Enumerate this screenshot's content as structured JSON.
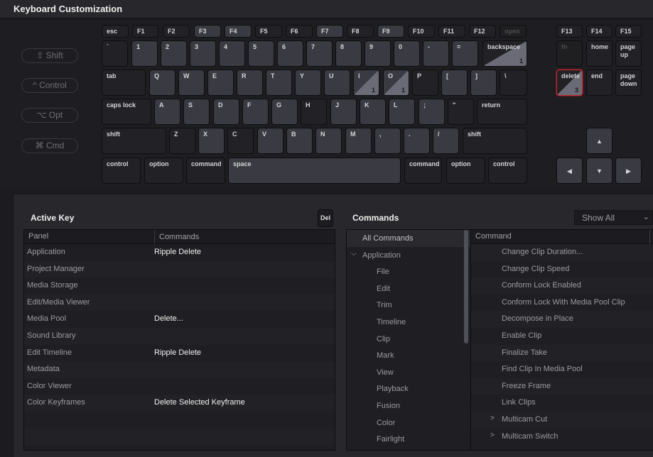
{
  "window": {
    "title": "Keyboard Customization"
  },
  "modifiers": [
    {
      "label": "⇧ Shift"
    },
    {
      "label": "^ Control"
    },
    {
      "label": "⌥ Opt"
    },
    {
      "label": "⌘ Cmd"
    }
  ],
  "keyboard": {
    "keys": [
      {
        "label": "esc",
        "style": "dark"
      },
      {
        "label": "F1",
        "style": "dark"
      },
      {
        "label": "F2",
        "style": "dark"
      },
      {
        "label": "F3",
        "style": "light"
      },
      {
        "label": "F4",
        "style": "light"
      },
      {
        "label": "F5",
        "style": "dark"
      },
      {
        "label": "F6",
        "style": "dark"
      },
      {
        "label": "F7",
        "style": "light"
      },
      {
        "label": "F8",
        "style": "dark"
      },
      {
        "label": "F9",
        "style": "light"
      },
      {
        "label": "F10",
        "style": "dark"
      },
      {
        "label": "F11",
        "style": "dark"
      },
      {
        "label": "F12",
        "style": "dark"
      },
      {
        "label": "open",
        "style": "disabled"
      },
      {
        "label": "F13",
        "style": "dark"
      },
      {
        "label": "F14",
        "style": "dark"
      },
      {
        "label": "F15",
        "style": "dark"
      },
      {
        "label": "`",
        "style": "dark"
      },
      {
        "label": "1",
        "style": "light"
      },
      {
        "label": "2",
        "style": "light"
      },
      {
        "label": "3",
        "style": "light"
      },
      {
        "label": "4",
        "style": "light"
      },
      {
        "label": "5",
        "style": "light"
      },
      {
        "label": "6",
        "style": "light"
      },
      {
        "label": "7",
        "style": "light"
      },
      {
        "label": "8",
        "style": "light"
      },
      {
        "label": "9",
        "style": "light"
      },
      {
        "label": "0",
        "style": "light"
      },
      {
        "label": "-",
        "style": "light"
      },
      {
        "label": "=",
        "style": "light"
      },
      {
        "label": "backspace",
        "style": "dark",
        "count": "1"
      },
      {
        "label": "fn",
        "style": "disabled"
      },
      {
        "label": "home",
        "style": "dark"
      },
      {
        "label": "page up",
        "style": "dark"
      },
      {
        "label": "tab",
        "style": "dark"
      },
      {
        "label": "Q",
        "style": "light"
      },
      {
        "label": "W",
        "style": "light"
      },
      {
        "label": "E",
        "style": "light"
      },
      {
        "label": "R",
        "style": "light"
      },
      {
        "label": "T",
        "style": "light"
      },
      {
        "label": "Y",
        "style": "light"
      },
      {
        "label": "U",
        "style": "light"
      },
      {
        "label": "I",
        "style": "light",
        "count": "1"
      },
      {
        "label": "O",
        "style": "light",
        "count": "1"
      },
      {
        "label": "P",
        "style": "dark"
      },
      {
        "label": "[",
        "style": "light"
      },
      {
        "label": "]",
        "style": "light"
      },
      {
        "label": "\\",
        "style": "dark"
      },
      {
        "label": "delete",
        "style": "dark",
        "count": "3",
        "selected": true
      },
      {
        "label": "end",
        "style": "dark"
      },
      {
        "label": "page down",
        "style": "dark"
      },
      {
        "label": "caps lock",
        "style": "dark"
      },
      {
        "label": "A",
        "style": "light"
      },
      {
        "label": "S",
        "style": "light"
      },
      {
        "label": "D",
        "style": "light"
      },
      {
        "label": "F",
        "style": "light"
      },
      {
        "label": "G",
        "style": "light"
      },
      {
        "label": "H",
        "style": "dark"
      },
      {
        "label": "J",
        "style": "light"
      },
      {
        "label": "K",
        "style": "light"
      },
      {
        "label": "L",
        "style": "light"
      },
      {
        "label": ";",
        "style": "light"
      },
      {
        "label": "\"",
        "style": "dark"
      },
      {
        "label": "return",
        "style": "dark"
      },
      {
        "label": "shift",
        "style": "dark"
      },
      {
        "label": "Z",
        "style": "dark"
      },
      {
        "label": "X",
        "style": "light"
      },
      {
        "label": "C",
        "style": "dark"
      },
      {
        "label": "V",
        "style": "light"
      },
      {
        "label": "B",
        "style": "light"
      },
      {
        "label": "N",
        "style": "light"
      },
      {
        "label": "M",
        "style": "light"
      },
      {
        "label": ",",
        "style": "light"
      },
      {
        "label": ".",
        "style": "light"
      },
      {
        "label": "/",
        "style": "light"
      },
      {
        "label": "shift",
        "style": "dark"
      },
      {
        "label": "▲",
        "style": "light",
        "arrow": true
      },
      {
        "label": "control",
        "style": "dark"
      },
      {
        "label": "option",
        "style": "dark"
      },
      {
        "label": "command",
        "style": "dark"
      },
      {
        "label": "space",
        "style": "light"
      },
      {
        "label": "command",
        "style": "dark"
      },
      {
        "label": "option",
        "style": "dark"
      },
      {
        "label": "control",
        "style": "dark"
      },
      {
        "label": "◀",
        "style": "light",
        "arrow": true
      },
      {
        "label": "▼",
        "style": "light",
        "arrow": true
      },
      {
        "label": "▶",
        "style": "light",
        "arrow": true
      }
    ]
  },
  "active_key": {
    "title": "Active Key",
    "del_button": "Del",
    "columns": [
      "Panel",
      "Commands"
    ],
    "rows": [
      {
        "panel": "Application",
        "command": "Ripple Delete"
      },
      {
        "panel": "Project Manager",
        "command": ""
      },
      {
        "panel": "Media Storage",
        "command": ""
      },
      {
        "panel": "Edit/Media Viewer",
        "command": ""
      },
      {
        "panel": "Media Pool",
        "command": "Delete..."
      },
      {
        "panel": "Sound Library",
        "command": ""
      },
      {
        "panel": "Edit Timeline",
        "command": "Ripple Delete"
      },
      {
        "panel": "Metadata",
        "command": ""
      },
      {
        "panel": "Color Viewer",
        "command": ""
      },
      {
        "panel": "Color Keyframes",
        "command": "Delete Selected Keyframe"
      }
    ]
  },
  "commands": {
    "title": "Commands",
    "filter": {
      "value": "Show All"
    },
    "tree": [
      {
        "label": "All Commands",
        "level": 0,
        "head": true
      },
      {
        "label": "Application",
        "level": 0,
        "expanded": true
      },
      {
        "label": "File",
        "level": 1
      },
      {
        "label": "Edit",
        "level": 1
      },
      {
        "label": "Trim",
        "level": 1
      },
      {
        "label": "Timeline",
        "level": 1
      },
      {
        "label": "Clip",
        "level": 1
      },
      {
        "label": "Mark",
        "level": 1
      },
      {
        "label": "View",
        "level": 1
      },
      {
        "label": "Playback",
        "level": 1
      },
      {
        "label": "Fusion",
        "level": 1
      },
      {
        "label": "Color",
        "level": 1
      },
      {
        "label": "Fairlight",
        "level": 1
      }
    ],
    "list_header": "Command",
    "list": [
      {
        "label": "Change Clip Duration..."
      },
      {
        "label": "Change Clip Speed"
      },
      {
        "label": "Conform Lock Enabled"
      },
      {
        "label": "Conform Lock With Media Pool Clip"
      },
      {
        "label": "Decompose in Place"
      },
      {
        "label": "Enable Clip"
      },
      {
        "label": "Finalize Take"
      },
      {
        "label": "Find Clip In Media Pool"
      },
      {
        "label": "Freeze Frame"
      },
      {
        "label": "Link Clips"
      },
      {
        "label": "Multicam Cut",
        "expandable": true
      },
      {
        "label": "Multicam Switch",
        "expandable": true
      }
    ]
  }
}
